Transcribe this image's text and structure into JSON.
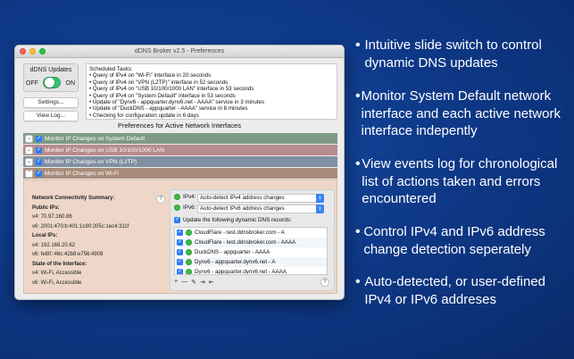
{
  "window": {
    "title": "dDNS Broker v2.5 - Preferences"
  },
  "ddns": {
    "label": "dDNS Updates",
    "off": "OFF",
    "on": "ON",
    "enabled": true
  },
  "buttons": {
    "settings": "Settings...",
    "view_log": "View Log..."
  },
  "tasks": {
    "header": "Scheduled Tasks:",
    "items": [
      "• Query of IPv4 on \"Wi-Fi\" interface in 20 seconds",
      "• Query of IPv4 on \"VPN (L2TP)\" interface in 52 seconds",
      "• Query of IPv4 on \"USB 10/100/1000 LAN\" interface in 53 seconds",
      "• Query of IPv4 on \"System Default\" interface in 53 seconds",
      "• Update of \"Dynv6 - appquarter.dynv6.net - AAAA\" service in 3 minutes",
      "• Update of \"DuckDNS - appquarter - AAAA\" service in 8 minutes",
      "• Checking for configuration update in 6 days"
    ]
  },
  "preferences_title": "Preferences for Active Network Interfaces",
  "interfaces": [
    "Monitor IP Changes on System Default",
    "Monitor IP Changes on USB 10/100/1000 LAN",
    "Monitor IP Changes on VPN (L2TP)",
    "Monitor IP Changes on Wi-Fi"
  ],
  "summary": {
    "title": "Network Connectivity Summary:",
    "public_title": "Public IPs:",
    "public_v4": "v4: 70.97.160.86",
    "public_v6": "v6: 2001:470:b:401:1c90:205c:1ec4:311f",
    "local_title": "Local IPs:",
    "local_v4": "v4: 192.168.20.62",
    "local_v6": "v6: fe80::46c:42b8:e756:4908",
    "state_title": "State of the Interface:",
    "state_v4": "v4: Wi-Fi, Accessible",
    "state_v6": "v6: Wi-Fi, Accessible"
  },
  "ip_settings": {
    "ipv4_label": "IPv4:",
    "ipv4_value": "Auto-detect IPv4 address changes",
    "ipv6_label": "IPv6:",
    "ipv6_value": "Auto-detect IPv6 address changes",
    "update_label": "Update the following dynamic DNS records:"
  },
  "records": [
    "CloudFlare - test.ddnsbroker.com - A",
    "CloudFlare - test.ddnsbroker.com - AAAA",
    "DuckDNS - appquarter - AAAA",
    "Dynv6 - appquarter.dynv6.net - A",
    "Dynv6 - appquarter.dynv6.net - AAAA"
  ],
  "toolbar": [
    "+",
    "—",
    "✎",
    "⇥",
    "⇤"
  ],
  "help": "?",
  "features": [
    "Intuitive slide switch to control dynamic DNS updates",
    "Monitor System Default network interface and each active network interface indepently",
    "View events log for chronological list of actions taken and errors encountered",
    "Control IPv4 and IPv6 address change detection seperately",
    "Auto-detected, or user-defined IPv4 or IPv6 addreses"
  ],
  "colors": {
    "background": "#0e3a8a",
    "switch_on": "#38c172",
    "checkbox": "#2f7cf6",
    "row_system_default": "#7f9a85",
    "row_usb_lan": "#b78c8c",
    "row_vpn": "#8190a0",
    "row_wifi": "#a88c7a",
    "panel_wifi": "#eed7c9"
  }
}
